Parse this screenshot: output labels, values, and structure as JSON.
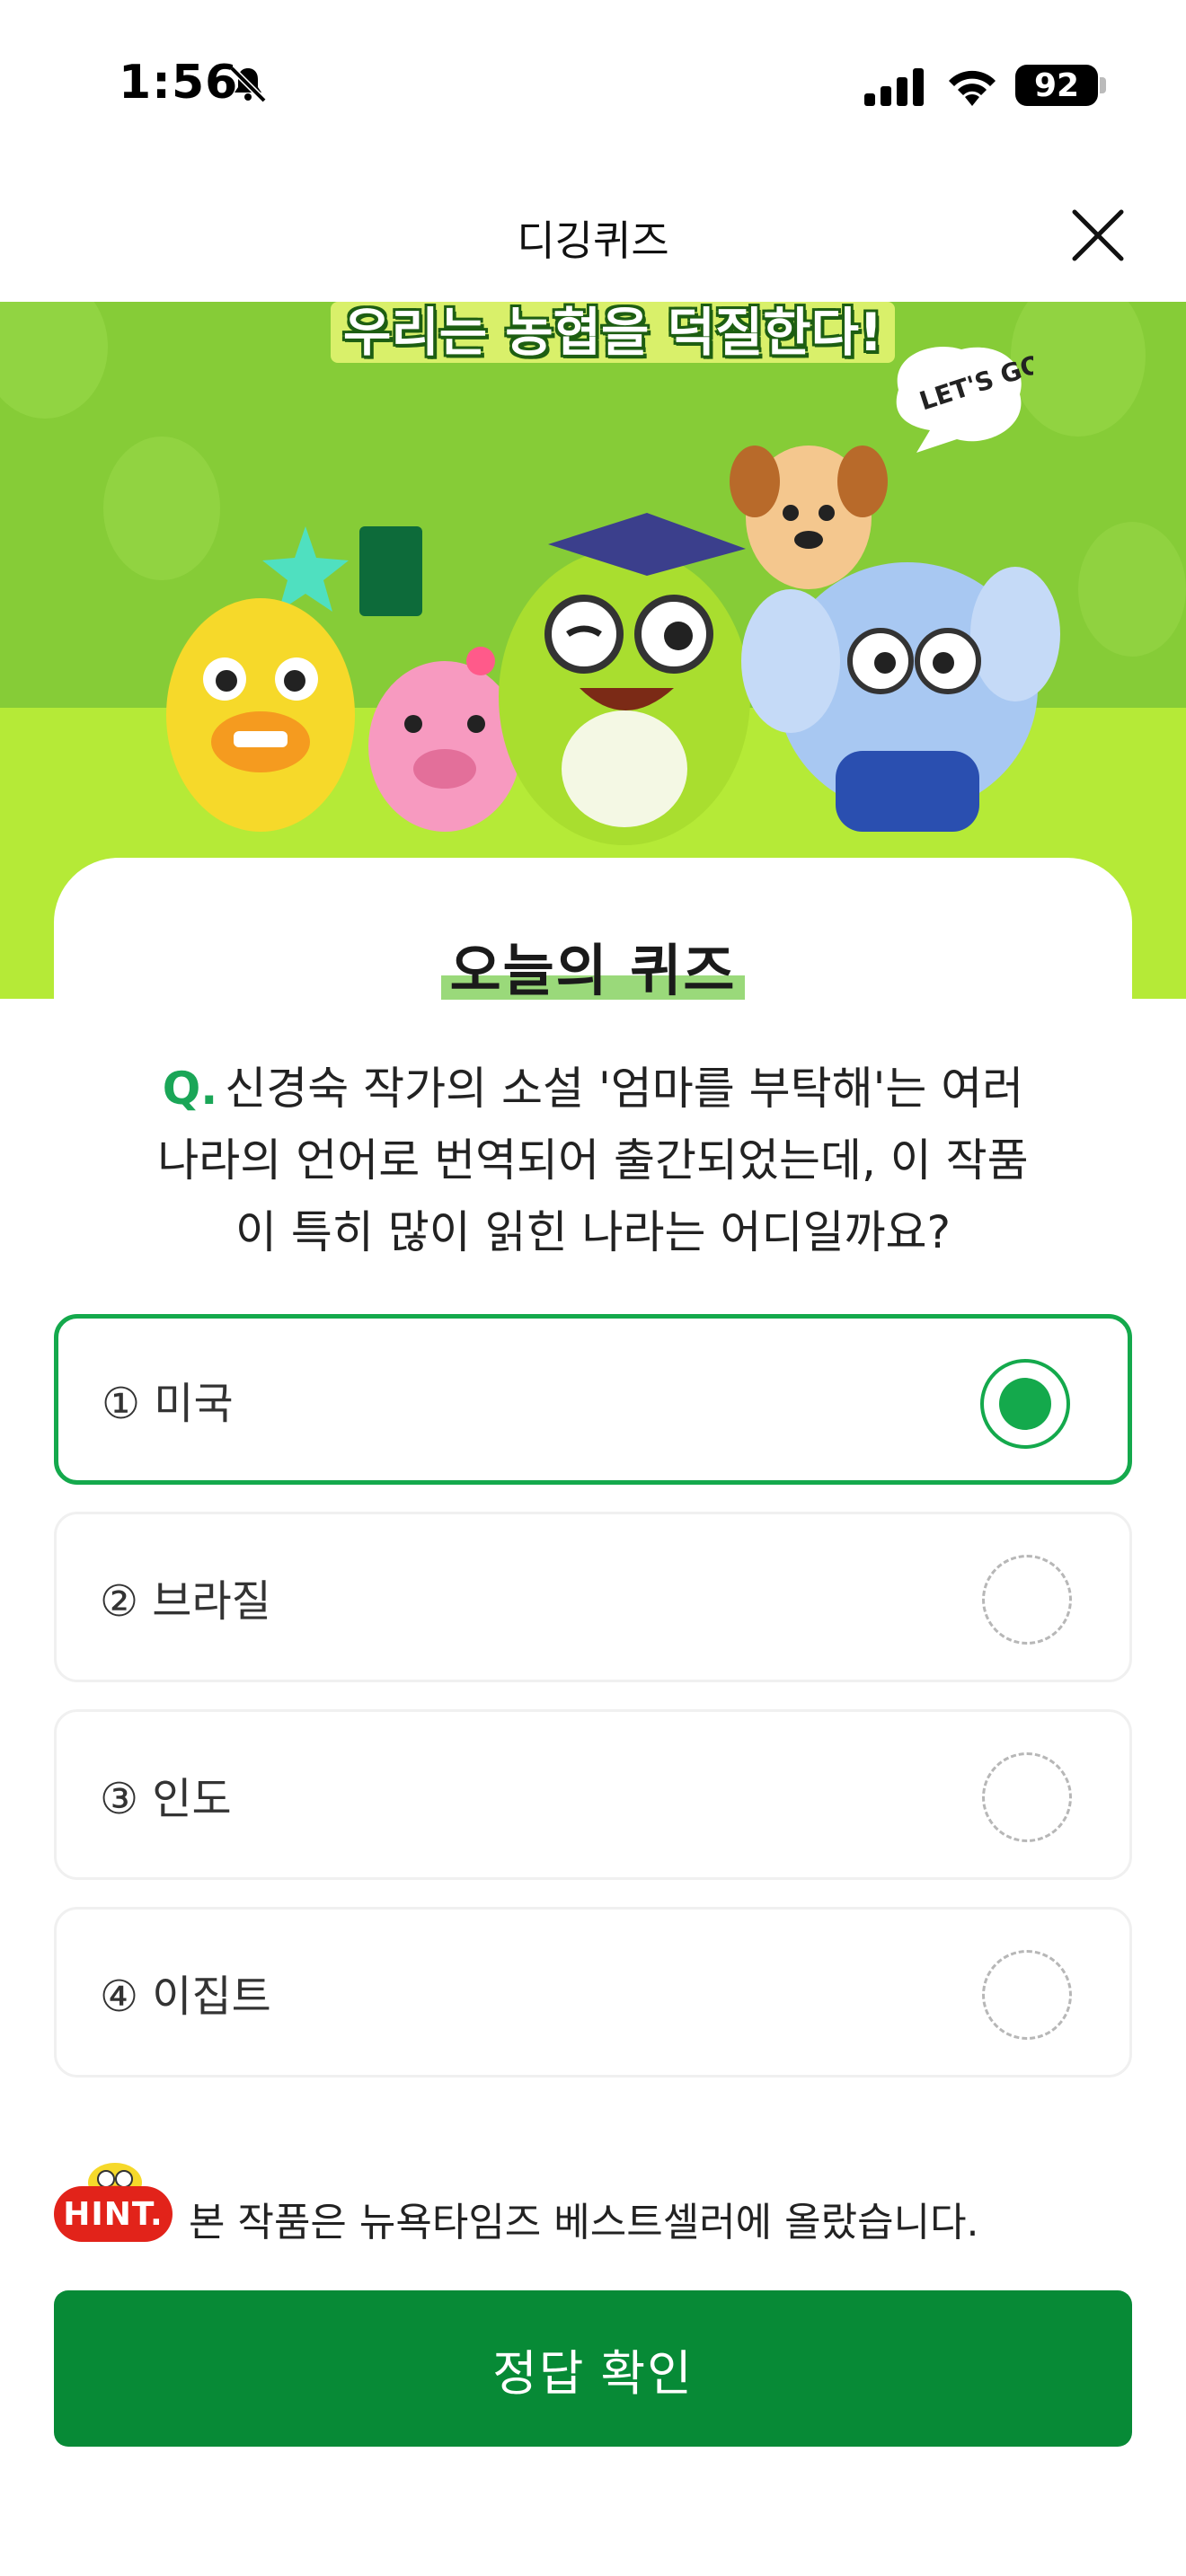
{
  "status_bar": {
    "time": "1:56",
    "battery": "92",
    "icons": [
      "bell-slash-icon",
      "signal-icon",
      "wifi-icon",
      "battery-icon"
    ]
  },
  "header": {
    "title": "디깅퀴즈",
    "close_icon": "close-icon"
  },
  "banner": {
    "title": "우리는 농협을 덕질한다!",
    "bubble_text": "LET'S GO!"
  },
  "quiz": {
    "heading": "오늘의 퀴즈",
    "question_mark": "Q.",
    "question_lines": [
      "신경숙 작가의 소설 '엄마를 부탁해'는 여러",
      "나라의 언어로 번역되어 출간되었는데, 이 작품",
      "이 특히 많이 읽힌 나라는 어디일까요?"
    ],
    "options": [
      {
        "label": "① 미국",
        "selected": true
      },
      {
        "label": "② 브라질",
        "selected": false
      },
      {
        "label": "③ 인도",
        "selected": false
      },
      {
        "label": "④ 이집트",
        "selected": false
      }
    ]
  },
  "hint": {
    "badge": "HINT.",
    "text": "본 작품은 뉴욕타임즈 베스트셀러에 올랐습니다."
  },
  "confirm_button": "정답 확인",
  "colors": {
    "accent": "#14a94c",
    "button": "#078a36",
    "banner_green": "#86cc37",
    "banner_lime": "#b5ea37",
    "hint_red": "#e2231a"
  }
}
